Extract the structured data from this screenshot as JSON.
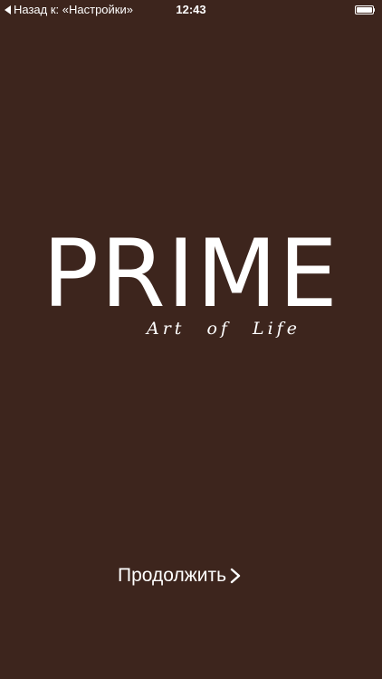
{
  "colors": {
    "background": "#3d251d",
    "text": "#ffffff"
  },
  "status_bar": {
    "back_label": "Назад к: «Настройки»",
    "time": "12:43",
    "back_icon": "back-chevron-icon",
    "battery_icon": "battery-icon",
    "battery_level": 1.0
  },
  "logo": {
    "title": "PRIME",
    "subtitle": "Art of Life"
  },
  "continue_button": {
    "label": "Продолжить",
    "icon": "chevron-right-icon"
  }
}
